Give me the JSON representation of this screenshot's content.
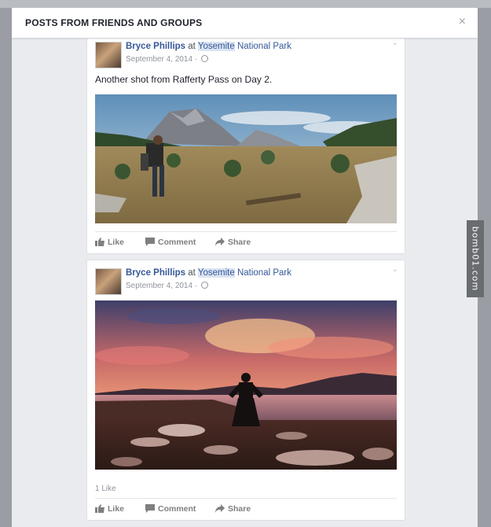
{
  "modal": {
    "title": "POSTS FROM FRIENDS AND GROUPS",
    "close_label": "×"
  },
  "posts": [
    {
      "author": "Bryce Phillips",
      "at_word": "at",
      "place_highlight": "Yosemite",
      "place_rest": "National Park",
      "date": "September 4, 2014 ·",
      "text": "Another shot from Rafferty Pass on Day 2.",
      "photo_icon": "hiker-mountain-meadow-photo",
      "like_count": "",
      "actions": {
        "like": "Like",
        "comment": "Comment",
        "share": "Share"
      }
    },
    {
      "author": "Bryce Phillips",
      "at_word": "at",
      "place_highlight": "Yosemite",
      "place_rest": "National Park",
      "date": "September 4, 2014 ·",
      "text": "",
      "photo_icon": "sunset-lake-photo",
      "like_count": "1 Like",
      "actions": {
        "like": "Like",
        "comment": "Comment",
        "share": "Share"
      }
    }
  ],
  "watermark": "bomb01.com",
  "colors": {
    "link_blue": "#365899",
    "page_bg": "#e9ebee",
    "overlay": "#9a9da3",
    "action_gray": "#7f7f7f"
  }
}
